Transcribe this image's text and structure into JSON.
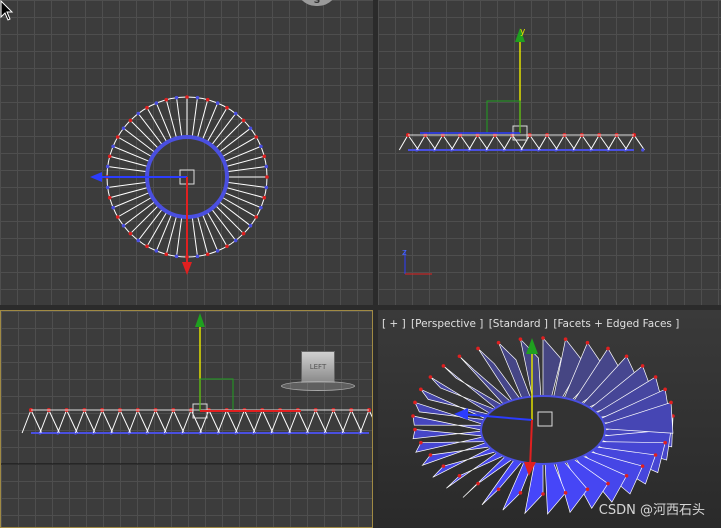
{
  "viewports": {
    "top": {
      "compass_letter": "S"
    },
    "front": {
      "axis_y": "y",
      "axis_z": "z"
    },
    "left": {
      "cube_label": "LEFT"
    },
    "perspective": {
      "labels": [
        "[ + ]",
        "[Perspective ]",
        "[Standard ]",
        "[Facets + Edged Faces ]"
      ]
    }
  },
  "watermark": "CSDN @河西石头",
  "colors": {
    "grid": "#4e4e4e",
    "background": "#3c3c3c",
    "ring": "#4a4fe0",
    "vertex": "#e02020",
    "active_border": "#a08a44"
  },
  "icons": [
    "cursor-arrow-icon",
    "view-cube-icon",
    "compass-icon"
  ]
}
